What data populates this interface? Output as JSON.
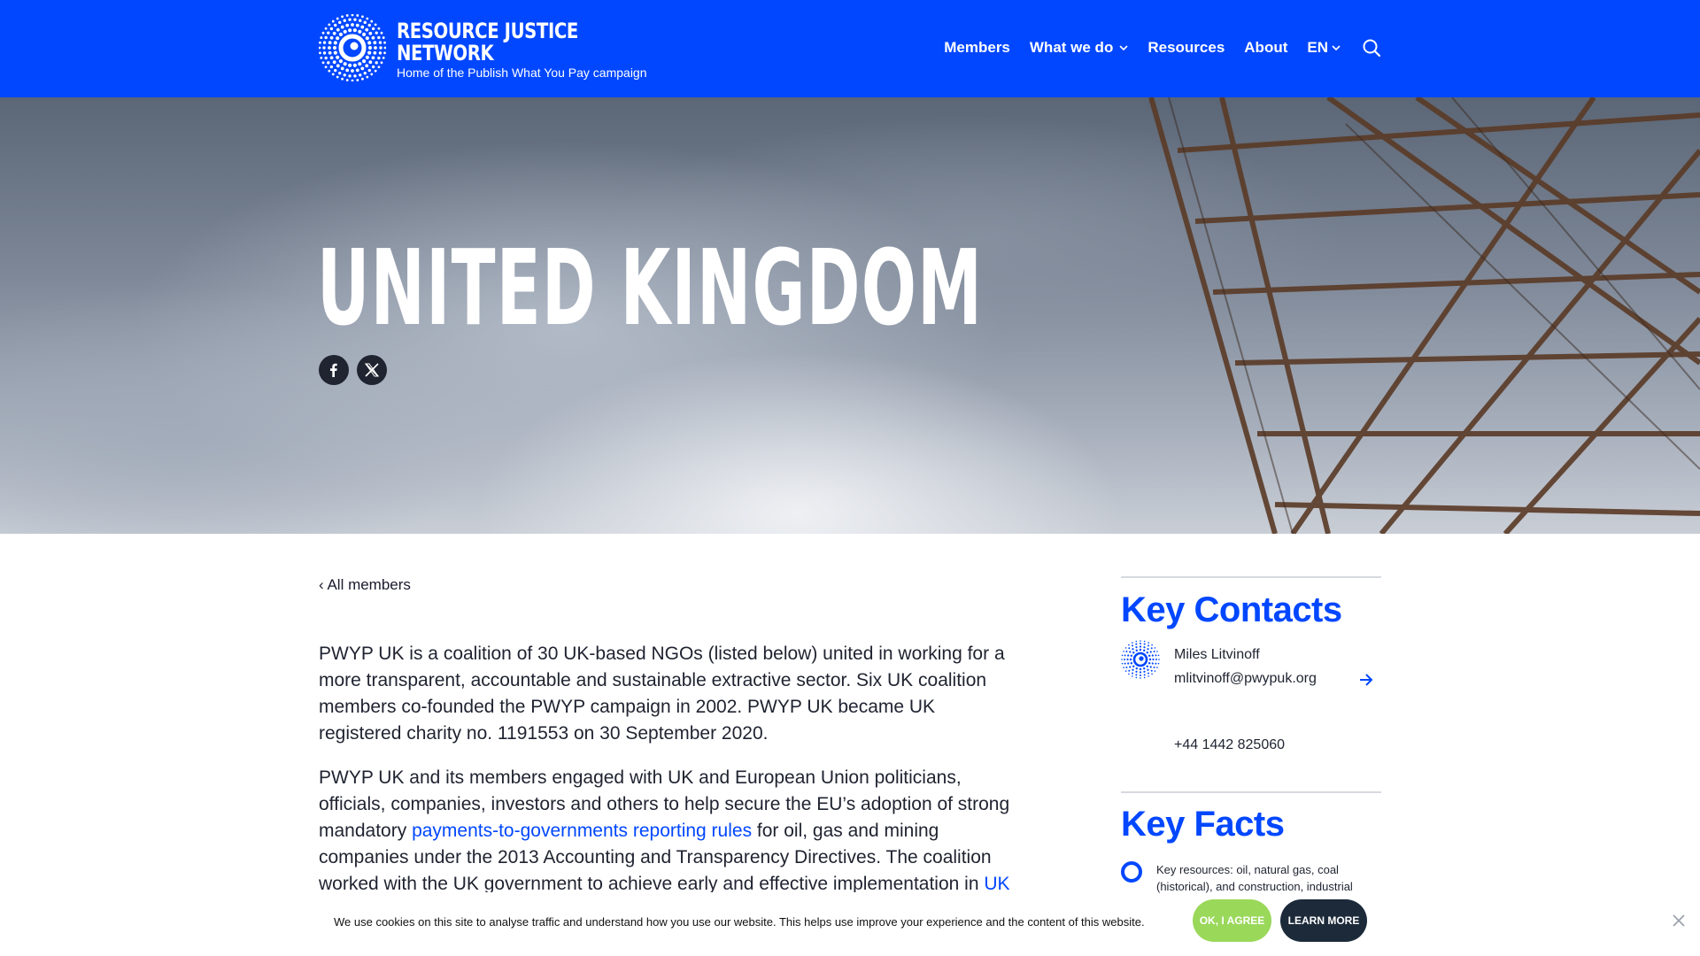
{
  "header": {
    "logo_line1": "RESOURCE JUSTICE",
    "logo_line2": "NETWORK",
    "tagline": "Home of the Publish What You Pay campaign",
    "nav": {
      "members": "Members",
      "what_we_do": "What we do",
      "resources": "Resources",
      "about": "About",
      "language": "EN"
    },
    "icons": [
      "logo-mark-icon",
      "chevron-down-icon",
      "search-icon"
    ]
  },
  "hero": {
    "title": "UNITED KINGDOM",
    "share_icons": [
      "facebook-icon",
      "x-icon"
    ]
  },
  "main": {
    "back_link": "All members",
    "paragraph1": "PWYP UK is a coalition of 30 UK-based NGOs (listed below) united in working for a more transparent, accountable and sustainable extractive sector. Six UK coalition members co-founded the PWYP campaign in 2002. PWYP UK became UK registered charity no. 1191553 on 30 September 2020.",
    "paragraph2_pre": "PWYP UK and its members engaged with UK and European Union politicians, officials, companies, investors and others to help secure the EU’s adoption of strong mandatory ",
    "paragraph2_link": "payments-to-governments reporting rules",
    "paragraph2_mid": " for oil, gas and mining companies under the 2013 Accounting and Transparency Directives. The coalition worked with the UK government to achieve early and effective implementation in ",
    "paragraph2_link2": "UK"
  },
  "sidebar": {
    "key_contacts_heading": "Key Contacts",
    "contact_name": "Miles Litvinoff",
    "contact_email": "mlitvinoff@pwypuk.org",
    "contact_phone": "+44 1442 825060",
    "key_facts_heading": "Key Facts",
    "fact1": "Key resources: oil, natural gas, coal (historical), and construction, industrial"
  },
  "cookie": {
    "text": "We use cookies on this site to analyse traffic and understand how you use our website. This helps use improve your experience and the content of this website.",
    "agree": "OK, I AGREE",
    "learn_more": "LEARN MORE"
  },
  "colors": {
    "brand_blue": "#0047ff",
    "agree_green": "#9ad85a",
    "dark_navy": "#1c2a3a"
  }
}
